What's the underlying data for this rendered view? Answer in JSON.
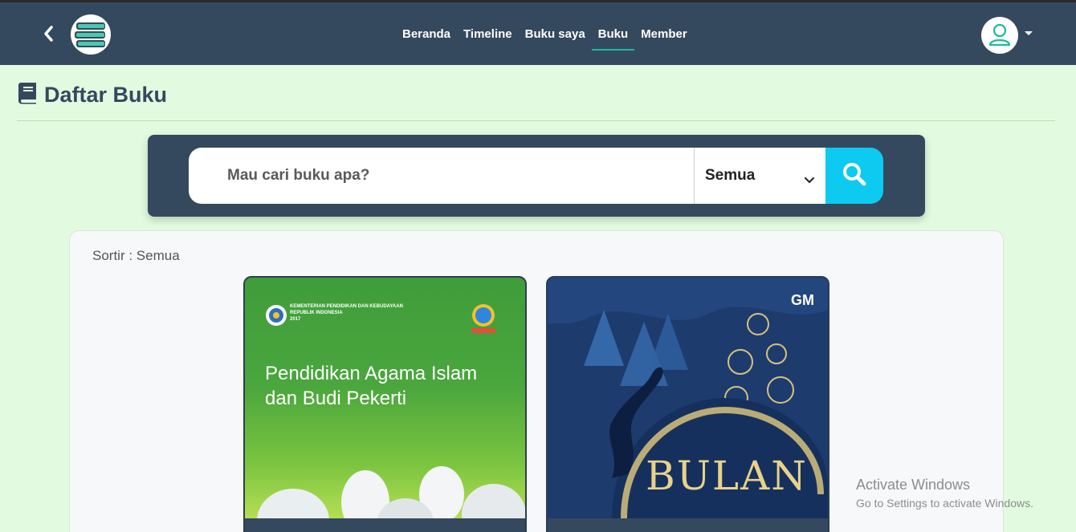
{
  "nav": {
    "links": [
      {
        "label": "Beranda",
        "active": false
      },
      {
        "label": "Timeline",
        "active": false
      },
      {
        "label": "Buku saya",
        "active": false
      },
      {
        "label": "Buku",
        "active": true
      },
      {
        "label": "Member",
        "active": false
      }
    ],
    "icons": {
      "back": "chevron-left-icon",
      "logo": "books-stack-icon",
      "avatar": "user-icon",
      "menu": "caret-down-icon"
    }
  },
  "page": {
    "title": "Daftar Buku",
    "title_icon": "book-icon"
  },
  "search": {
    "placeholder": "Mau cari buku apa?",
    "filter_selected": "Semua",
    "button_icon": "search-icon"
  },
  "books_panel": {
    "sort_label": "Sortir : Semua",
    "books": [
      {
        "cover_org": "KEMENTERIAN PENDIDIKAN DAN KEBUDAYAAN\nREPUBLIK INDONESIA\n2017",
        "cover_title": "Pendidikan Agama Islam dan Budi Pekerti"
      },
      {
        "cover_mark": "GM",
        "cover_title": "BULAN"
      }
    ]
  },
  "watermark": {
    "line1": "Activate Windows",
    "line2": "Go to Settings to activate Windows."
  },
  "colors": {
    "navbar": "#34495e",
    "accent": "#1abc9c",
    "page_bg": "#e2fbe0",
    "search_button": "#0dcaf0"
  }
}
